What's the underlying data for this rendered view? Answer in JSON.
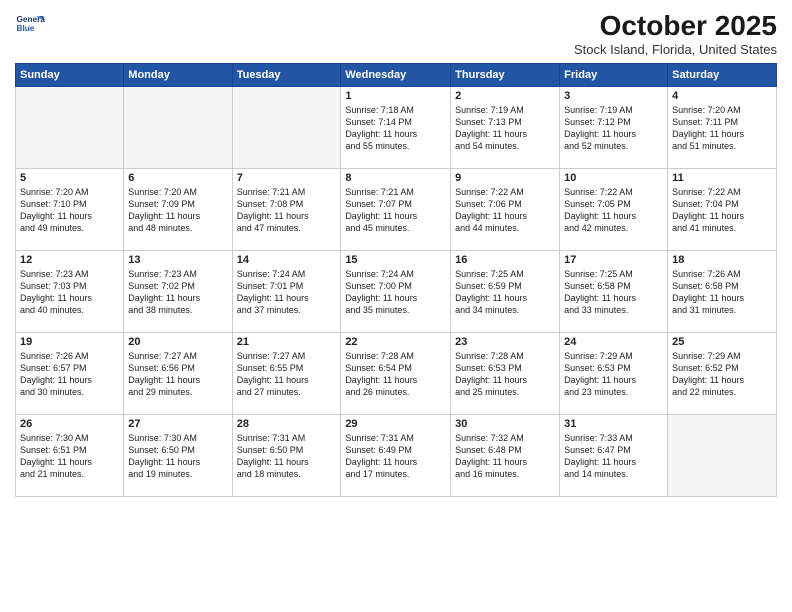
{
  "header": {
    "logo_line1": "General",
    "logo_line2": "Blue",
    "title": "October 2025",
    "location": "Stock Island, Florida, United States"
  },
  "weekdays": [
    "Sunday",
    "Monday",
    "Tuesday",
    "Wednesday",
    "Thursday",
    "Friday",
    "Saturday"
  ],
  "weeks": [
    [
      {
        "day": "",
        "info": ""
      },
      {
        "day": "",
        "info": ""
      },
      {
        "day": "",
        "info": ""
      },
      {
        "day": "1",
        "info": "Sunrise: 7:18 AM\nSunset: 7:14 PM\nDaylight: 11 hours\nand 55 minutes."
      },
      {
        "day": "2",
        "info": "Sunrise: 7:19 AM\nSunset: 7:13 PM\nDaylight: 11 hours\nand 54 minutes."
      },
      {
        "day": "3",
        "info": "Sunrise: 7:19 AM\nSunset: 7:12 PM\nDaylight: 11 hours\nand 52 minutes."
      },
      {
        "day": "4",
        "info": "Sunrise: 7:20 AM\nSunset: 7:11 PM\nDaylight: 11 hours\nand 51 minutes."
      }
    ],
    [
      {
        "day": "5",
        "info": "Sunrise: 7:20 AM\nSunset: 7:10 PM\nDaylight: 11 hours\nand 49 minutes."
      },
      {
        "day": "6",
        "info": "Sunrise: 7:20 AM\nSunset: 7:09 PM\nDaylight: 11 hours\nand 48 minutes."
      },
      {
        "day": "7",
        "info": "Sunrise: 7:21 AM\nSunset: 7:08 PM\nDaylight: 11 hours\nand 47 minutes."
      },
      {
        "day": "8",
        "info": "Sunrise: 7:21 AM\nSunset: 7:07 PM\nDaylight: 11 hours\nand 45 minutes."
      },
      {
        "day": "9",
        "info": "Sunrise: 7:22 AM\nSunset: 7:06 PM\nDaylight: 11 hours\nand 44 minutes."
      },
      {
        "day": "10",
        "info": "Sunrise: 7:22 AM\nSunset: 7:05 PM\nDaylight: 11 hours\nand 42 minutes."
      },
      {
        "day": "11",
        "info": "Sunrise: 7:22 AM\nSunset: 7:04 PM\nDaylight: 11 hours\nand 41 minutes."
      }
    ],
    [
      {
        "day": "12",
        "info": "Sunrise: 7:23 AM\nSunset: 7:03 PM\nDaylight: 11 hours\nand 40 minutes."
      },
      {
        "day": "13",
        "info": "Sunrise: 7:23 AM\nSunset: 7:02 PM\nDaylight: 11 hours\nand 38 minutes."
      },
      {
        "day": "14",
        "info": "Sunrise: 7:24 AM\nSunset: 7:01 PM\nDaylight: 11 hours\nand 37 minutes."
      },
      {
        "day": "15",
        "info": "Sunrise: 7:24 AM\nSunset: 7:00 PM\nDaylight: 11 hours\nand 35 minutes."
      },
      {
        "day": "16",
        "info": "Sunrise: 7:25 AM\nSunset: 6:59 PM\nDaylight: 11 hours\nand 34 minutes."
      },
      {
        "day": "17",
        "info": "Sunrise: 7:25 AM\nSunset: 6:58 PM\nDaylight: 11 hours\nand 33 minutes."
      },
      {
        "day": "18",
        "info": "Sunrise: 7:26 AM\nSunset: 6:58 PM\nDaylight: 11 hours\nand 31 minutes."
      }
    ],
    [
      {
        "day": "19",
        "info": "Sunrise: 7:26 AM\nSunset: 6:57 PM\nDaylight: 11 hours\nand 30 minutes."
      },
      {
        "day": "20",
        "info": "Sunrise: 7:27 AM\nSunset: 6:56 PM\nDaylight: 11 hours\nand 29 minutes."
      },
      {
        "day": "21",
        "info": "Sunrise: 7:27 AM\nSunset: 6:55 PM\nDaylight: 11 hours\nand 27 minutes."
      },
      {
        "day": "22",
        "info": "Sunrise: 7:28 AM\nSunset: 6:54 PM\nDaylight: 11 hours\nand 26 minutes."
      },
      {
        "day": "23",
        "info": "Sunrise: 7:28 AM\nSunset: 6:53 PM\nDaylight: 11 hours\nand 25 minutes."
      },
      {
        "day": "24",
        "info": "Sunrise: 7:29 AM\nSunset: 6:53 PM\nDaylight: 11 hours\nand 23 minutes."
      },
      {
        "day": "25",
        "info": "Sunrise: 7:29 AM\nSunset: 6:52 PM\nDaylight: 11 hours\nand 22 minutes."
      }
    ],
    [
      {
        "day": "26",
        "info": "Sunrise: 7:30 AM\nSunset: 6:51 PM\nDaylight: 11 hours\nand 21 minutes."
      },
      {
        "day": "27",
        "info": "Sunrise: 7:30 AM\nSunset: 6:50 PM\nDaylight: 11 hours\nand 19 minutes."
      },
      {
        "day": "28",
        "info": "Sunrise: 7:31 AM\nSunset: 6:50 PM\nDaylight: 11 hours\nand 18 minutes."
      },
      {
        "day": "29",
        "info": "Sunrise: 7:31 AM\nSunset: 6:49 PM\nDaylight: 11 hours\nand 17 minutes."
      },
      {
        "day": "30",
        "info": "Sunrise: 7:32 AM\nSunset: 6:48 PM\nDaylight: 11 hours\nand 16 minutes."
      },
      {
        "day": "31",
        "info": "Sunrise: 7:33 AM\nSunset: 6:47 PM\nDaylight: 11 hours\nand 14 minutes."
      },
      {
        "day": "",
        "info": ""
      }
    ]
  ]
}
